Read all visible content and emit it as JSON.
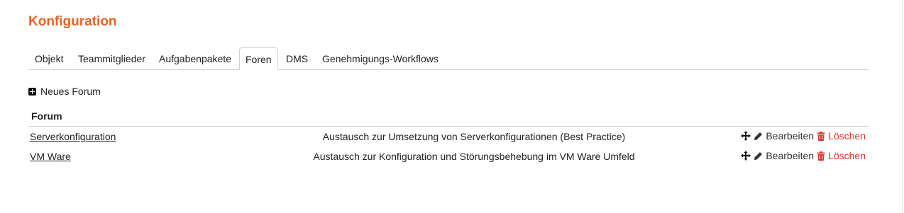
{
  "page": {
    "title": "Konfiguration"
  },
  "tabs": [
    {
      "label": "Objekt",
      "active": false
    },
    {
      "label": "Teammitglieder",
      "active": false
    },
    {
      "label": "Aufgabenpakete",
      "active": false
    },
    {
      "label": "Foren",
      "active": true
    },
    {
      "label": "DMS",
      "active": false
    },
    {
      "label": "Genehmigungs-Workflows",
      "active": false
    }
  ],
  "toolbar": {
    "new_forum_label": "Neues Forum"
  },
  "table": {
    "header": "Forum",
    "rows": [
      {
        "name": "Serverkonfiguration",
        "description": "Austausch zur Umsetzung von Serverkonfigurationen (Best Practice)",
        "edit_label": "Bearbeiten",
        "delete_label": "Löschen"
      },
      {
        "name": "VM Ware",
        "description": "Austausch zur Konfiguration und Störungsbehebung im VM Ware Umfeld",
        "edit_label": "Bearbeiten",
        "delete_label": "Löschen"
      }
    ]
  },
  "icons": {
    "new": "plus-square-icon",
    "move": "arrows-move-icon",
    "edit": "pencil-icon",
    "delete": "trash-icon"
  },
  "colors": {
    "accent": "#e8632b",
    "delete": "#d9342b",
    "text": "#222222",
    "border": "#d0d0d0"
  }
}
